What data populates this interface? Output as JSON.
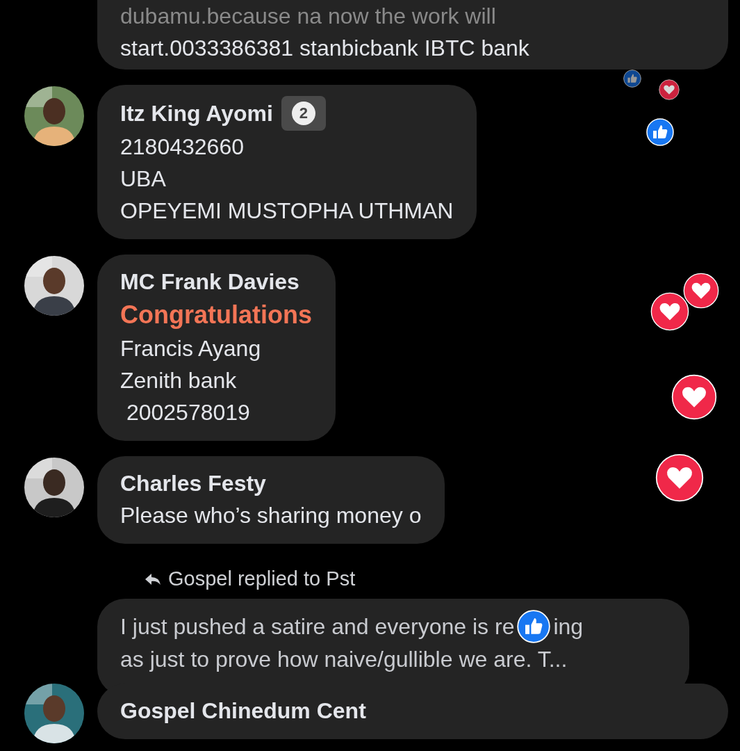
{
  "comments": [
    {
      "kind": "cut",
      "lines": [
        "dubamu.because na now the work will",
        "start.0033386381 stanbicbank IBTC bank"
      ]
    },
    {
      "kind": "comment",
      "name": "Itz King Ayomi",
      "badge": "2",
      "lines": [
        "2180432660",
        "UBA",
        "OPEYEMI MUSTOPHA UTHMAN"
      ]
    },
    {
      "kind": "comment",
      "name": "MC Frank Davies",
      "highlight": "Congratulations",
      "lines": [
        "Francis Ayang",
        "Zenith bank",
        " 2002578019"
      ]
    },
    {
      "kind": "comment",
      "name": "Charles Festy",
      "lines": [
        "Please who’s sharing money o"
      ]
    },
    {
      "kind": "reply",
      "context": "Gospel replied to Pst",
      "segments": [
        [
          "I just pushed a satire and everyone is re",
          "ing"
        ],
        [
          "as just to prove how naive/gullible we are. T..."
        ]
      ]
    },
    {
      "kind": "comment",
      "name": "Gospel Chinedum Cent"
    }
  ]
}
